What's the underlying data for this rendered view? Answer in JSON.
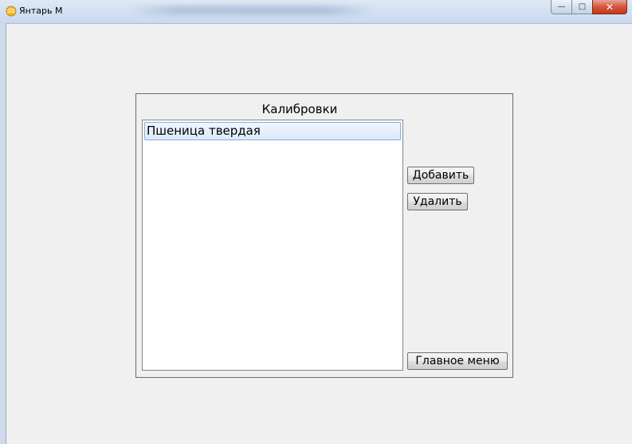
{
  "window": {
    "title": "Янтарь М",
    "controls": {
      "minimize": "—",
      "maximize": "□",
      "close": "✕"
    }
  },
  "calibrations": {
    "title": "Калибровки",
    "items": [
      "Пшеница твердая"
    ],
    "selected_index": 0,
    "buttons": {
      "add": "Добавить",
      "delete": "Удалить",
      "main_menu": "Главное меню"
    }
  },
  "colors": {
    "background": "#f0f0f0",
    "selection": "#dceafb",
    "selection_border": "#84acdd"
  }
}
